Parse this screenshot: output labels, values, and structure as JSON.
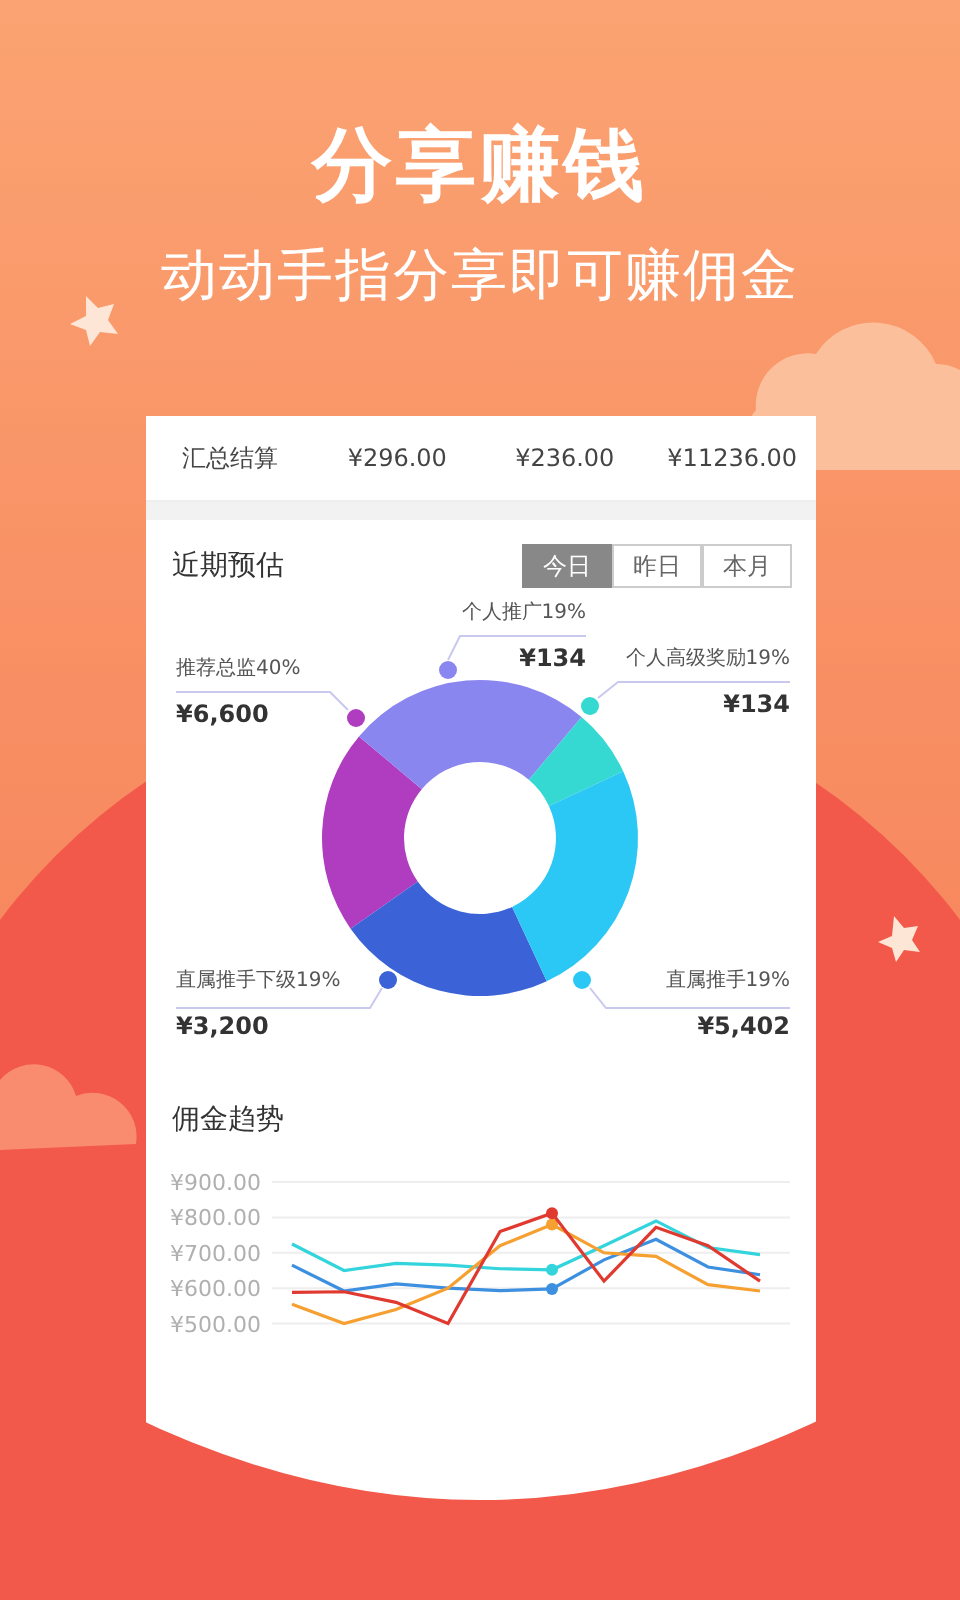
{
  "headline": "分享赚钱",
  "subtitle": "动动手指分享即可赚佣金",
  "summary": {
    "label": "汇总结算",
    "values": [
      "¥296.00",
      "¥236.00",
      "¥11236.00"
    ]
  },
  "estimate": {
    "title": "近期预估",
    "tabs": [
      {
        "label": "今日",
        "selected": true
      },
      {
        "label": "昨日",
        "selected": false
      },
      {
        "label": "本月",
        "selected": false
      }
    ],
    "segments": [
      {
        "name": "推荐总监40%",
        "amount": "¥6,600",
        "color": "#b03cc0"
      },
      {
        "name": "个人推广19%",
        "amount": "¥134",
        "color": "#8a86f0"
      },
      {
        "name": "个人高级奖励19%",
        "amount": "¥134",
        "color": "#35d9d2"
      },
      {
        "name": "直属推手下级19%",
        "amount": "¥3,200",
        "color": "#3b62d6"
      },
      {
        "name": "直属推手19%",
        "amount": "¥5,402",
        "color": "#2cc8f5"
      }
    ]
  },
  "trend": {
    "title": "佣金趋势",
    "chart_data": {
      "type": "line",
      "grid": true,
      "ylim": [
        500,
        900
      ],
      "yticks": [
        {
          "value": 900,
          "label": "¥900.00"
        },
        {
          "value": 800,
          "label": "¥800.00"
        },
        {
          "value": 700,
          "label": "¥700.00"
        },
        {
          "value": 600,
          "label": "¥600.00"
        },
        {
          "value": 500,
          "label": "¥500.00"
        }
      ],
      "series": [
        {
          "color": "#33d4dc",
          "values": [
            725,
            650,
            670,
            665,
            655,
            652,
            720,
            790,
            715,
            695
          ]
        },
        {
          "color": "#3d8fe0",
          "values": [
            665,
            592,
            612,
            600,
            593,
            598,
            680,
            738,
            660,
            638
          ]
        },
        {
          "color": "#f5a030",
          "values": [
            555,
            500,
            540,
            600,
            720,
            780,
            700,
            690,
            610,
            592
          ]
        },
        {
          "color": "#e03a30",
          "values": [
            588,
            590,
            560,
            500,
            760,
            812,
            620,
            772,
            720,
            620
          ]
        }
      ]
    }
  }
}
